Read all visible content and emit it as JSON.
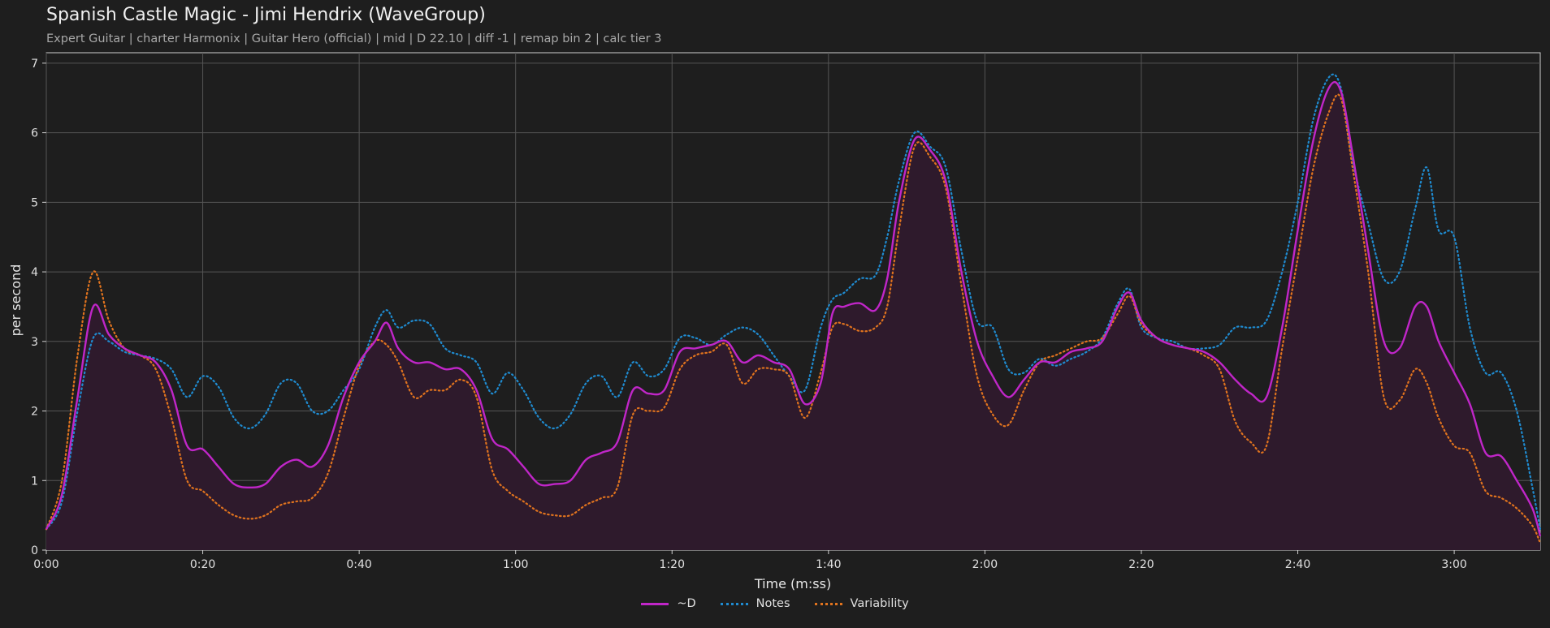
{
  "header": {
    "title": "Spanish Castle Magic - Jimi Hendrix (WaveGroup)",
    "subtitle": "Expert Guitar  |  charter Harmonix  |  Guitar Hero (official)  |  mid  |  D 22.10  |  diff -1  |  remap bin 2  |  calc tier 3"
  },
  "colors": {
    "background": "#1e1e1e",
    "plot_background": "#1e1e1e",
    "grid": "#555555",
    "d_series": "#c026c8",
    "notes_series": "#1f8bd0",
    "variability_series": "#e0731e",
    "d_fill": "#2e1a2c"
  },
  "chart_data": {
    "type": "line",
    "title": "Spanish Castle Magic - Jimi Hendrix (WaveGroup)",
    "xlabel": "Time (m:ss)",
    "ylabel": "per second",
    "xlim": [
      0,
      191
    ],
    "ylim": [
      0,
      7.15
    ],
    "x_ticks": [
      0,
      20,
      40,
      60,
      80,
      100,
      120,
      140,
      160,
      180
    ],
    "x_tick_labels": [
      "0:00",
      "0:20",
      "0:40",
      "1:00",
      "1:20",
      "1:40",
      "2:00",
      "2:20",
      "2:40",
      "3:00"
    ],
    "y_ticks": [
      0,
      1,
      2,
      3,
      4,
      5,
      6,
      7
    ],
    "y_tick_labels": [
      "0",
      "1",
      "2",
      "3",
      "4",
      "5",
      "6",
      "7"
    ],
    "grid": true,
    "legend_position": "bottom-center",
    "series": [
      {
        "name": "~D",
        "style": "solid",
        "filled": true,
        "points": [
          [
            0,
            0.3
          ],
          [
            2,
            0.8
          ],
          [
            4,
            2.2
          ],
          [
            6,
            3.5
          ],
          [
            8,
            3.1
          ],
          [
            10,
            2.9
          ],
          [
            12,
            2.8
          ],
          [
            14,
            2.7
          ],
          [
            16,
            2.3
          ],
          [
            18,
            1.5
          ],
          [
            20,
            1.45
          ],
          [
            22,
            1.2
          ],
          [
            24,
            0.95
          ],
          [
            26,
            0.9
          ],
          [
            28,
            0.95
          ],
          [
            30,
            1.2
          ],
          [
            32,
            1.3
          ],
          [
            34,
            1.2
          ],
          [
            36,
            1.5
          ],
          [
            38,
            2.2
          ],
          [
            40,
            2.7
          ],
          [
            42,
            3.0
          ],
          [
            43.5,
            3.27
          ],
          [
            45,
            2.9
          ],
          [
            47,
            2.7
          ],
          [
            49,
            2.7
          ],
          [
            51,
            2.6
          ],
          [
            53,
            2.6
          ],
          [
            55,
            2.3
          ],
          [
            57,
            1.6
          ],
          [
            59,
            1.45
          ],
          [
            61,
            1.2
          ],
          [
            63,
            0.95
          ],
          [
            65,
            0.95
          ],
          [
            67,
            1.0
          ],
          [
            69,
            1.3
          ],
          [
            71,
            1.4
          ],
          [
            73,
            1.55
          ],
          [
            75,
            2.3
          ],
          [
            77,
            2.25
          ],
          [
            79,
            2.3
          ],
          [
            81,
            2.85
          ],
          [
            83,
            2.9
          ],
          [
            85,
            2.95
          ],
          [
            87,
            3.0
          ],
          [
            89,
            2.7
          ],
          [
            91,
            2.8
          ],
          [
            93,
            2.7
          ],
          [
            95,
            2.6
          ],
          [
            97,
            2.1
          ],
          [
            99,
            2.4
          ],
          [
            100.5,
            3.4
          ],
          [
            102,
            3.5
          ],
          [
            104,
            3.55
          ],
          [
            106,
            3.45
          ],
          [
            107.5,
            3.9
          ],
          [
            109,
            5.0
          ],
          [
            111,
            5.9
          ],
          [
            113,
            5.75
          ],
          [
            115,
            5.3
          ],
          [
            117,
            4.0
          ],
          [
            119,
            3.0
          ],
          [
            121,
            2.5
          ],
          [
            123,
            2.2
          ],
          [
            125,
            2.45
          ],
          [
            127,
            2.7
          ],
          [
            129,
            2.7
          ],
          [
            131,
            2.85
          ],
          [
            133,
            2.9
          ],
          [
            135,
            3.0
          ],
          [
            137,
            3.5
          ],
          [
            138.5,
            3.7
          ],
          [
            140,
            3.3
          ],
          [
            142,
            3.05
          ],
          [
            144,
            2.95
          ],
          [
            146,
            2.9
          ],
          [
            148,
            2.85
          ],
          [
            150,
            2.7
          ],
          [
            152,
            2.45
          ],
          [
            154,
            2.25
          ],
          [
            156,
            2.2
          ],
          [
            158,
            3.2
          ],
          [
            160,
            4.6
          ],
          [
            162,
            5.9
          ],
          [
            164,
            6.65
          ],
          [
            165.5,
            6.6
          ],
          [
            167,
            5.7
          ],
          [
            169,
            4.3
          ],
          [
            171,
            3.0
          ],
          [
            173,
            2.9
          ],
          [
            175,
            3.5
          ],
          [
            176.5,
            3.5
          ],
          [
            178,
            3.0
          ],
          [
            180,
            2.55
          ],
          [
            182,
            2.1
          ],
          [
            184,
            1.4
          ],
          [
            186,
            1.35
          ],
          [
            188,
            1.0
          ],
          [
            190,
            0.6
          ],
          [
            191,
            0.2
          ]
        ]
      },
      {
        "name": "Notes",
        "style": "dotted",
        "filled": false,
        "points": [
          [
            0,
            0.3
          ],
          [
            2,
            0.7
          ],
          [
            4,
            2.0
          ],
          [
            6,
            3.05
          ],
          [
            8,
            3.0
          ],
          [
            10,
            2.85
          ],
          [
            12,
            2.8
          ],
          [
            14,
            2.75
          ],
          [
            16,
            2.6
          ],
          [
            18,
            2.2
          ],
          [
            20,
            2.5
          ],
          [
            22,
            2.35
          ],
          [
            24,
            1.9
          ],
          [
            26,
            1.75
          ],
          [
            28,
            1.95
          ],
          [
            30,
            2.4
          ],
          [
            32,
            2.4
          ],
          [
            34,
            2.0
          ],
          [
            36,
            2.0
          ],
          [
            38,
            2.3
          ],
          [
            40,
            2.6
          ],
          [
            42,
            3.2
          ],
          [
            43.5,
            3.45
          ],
          [
            45,
            3.2
          ],
          [
            47,
            3.3
          ],
          [
            49,
            3.25
          ],
          [
            51,
            2.9
          ],
          [
            53,
            2.8
          ],
          [
            55,
            2.7
          ],
          [
            57,
            2.25
          ],
          [
            59,
            2.55
          ],
          [
            61,
            2.3
          ],
          [
            63,
            1.9
          ],
          [
            65,
            1.75
          ],
          [
            67,
            1.95
          ],
          [
            69,
            2.4
          ],
          [
            71,
            2.5
          ],
          [
            73,
            2.2
          ],
          [
            75,
            2.7
          ],
          [
            77,
            2.5
          ],
          [
            79,
            2.6
          ],
          [
            81,
            3.05
          ],
          [
            83,
            3.05
          ],
          [
            85,
            2.95
          ],
          [
            87,
            3.1
          ],
          [
            89,
            3.2
          ],
          [
            91,
            3.1
          ],
          [
            93,
            2.8
          ],
          [
            95,
            2.5
          ],
          [
            97,
            2.3
          ],
          [
            99,
            3.2
          ],
          [
            100.5,
            3.6
          ],
          [
            102,
            3.7
          ],
          [
            104,
            3.9
          ],
          [
            106,
            3.95
          ],
          [
            107.5,
            4.5
          ],
          [
            109,
            5.3
          ],
          [
            111,
            6.0
          ],
          [
            113,
            5.8
          ],
          [
            115,
            5.5
          ],
          [
            117,
            4.3
          ],
          [
            119,
            3.3
          ],
          [
            121,
            3.2
          ],
          [
            123,
            2.6
          ],
          [
            125,
            2.55
          ],
          [
            127,
            2.75
          ],
          [
            129,
            2.65
          ],
          [
            131,
            2.75
          ],
          [
            133,
            2.85
          ],
          [
            135,
            3.05
          ],
          [
            137,
            3.55
          ],
          [
            138.5,
            3.75
          ],
          [
            140,
            3.2
          ],
          [
            142,
            3.05
          ],
          [
            144,
            3.0
          ],
          [
            146,
            2.9
          ],
          [
            148,
            2.9
          ],
          [
            150,
            2.95
          ],
          [
            152,
            3.2
          ],
          [
            154,
            3.2
          ],
          [
            156,
            3.3
          ],
          [
            158,
            4.0
          ],
          [
            160,
            5.0
          ],
          [
            162,
            6.2
          ],
          [
            164,
            6.8
          ],
          [
            165.5,
            6.65
          ],
          [
            167,
            5.6
          ],
          [
            169,
            4.7
          ],
          [
            171,
            3.9
          ],
          [
            173,
            4.0
          ],
          [
            175,
            4.9
          ],
          [
            176.5,
            5.5
          ],
          [
            178,
            4.6
          ],
          [
            180,
            4.5
          ],
          [
            182,
            3.2
          ],
          [
            184,
            2.55
          ],
          [
            186,
            2.55
          ],
          [
            188,
            2.0
          ],
          [
            190,
            0.9
          ],
          [
            191,
            0.3
          ]
        ]
      },
      {
        "name": "Variability",
        "style": "dotted",
        "filled": false,
        "points": [
          [
            0,
            0.3
          ],
          [
            2,
            1.0
          ],
          [
            4,
            2.8
          ],
          [
            6,
            4.0
          ],
          [
            8,
            3.3
          ],
          [
            10,
            2.9
          ],
          [
            12,
            2.8
          ],
          [
            14,
            2.6
          ],
          [
            16,
            1.9
          ],
          [
            18,
            1.0
          ],
          [
            20,
            0.85
          ],
          [
            22,
            0.65
          ],
          [
            24,
            0.5
          ],
          [
            26,
            0.45
          ],
          [
            28,
            0.5
          ],
          [
            30,
            0.65
          ],
          [
            32,
            0.7
          ],
          [
            34,
            0.75
          ],
          [
            36,
            1.1
          ],
          [
            38,
            1.9
          ],
          [
            40,
            2.65
          ],
          [
            42,
            3.0
          ],
          [
            43.5,
            2.95
          ],
          [
            45,
            2.7
          ],
          [
            47,
            2.2
          ],
          [
            49,
            2.3
          ],
          [
            51,
            2.3
          ],
          [
            53,
            2.45
          ],
          [
            55,
            2.2
          ],
          [
            57,
            1.15
          ],
          [
            59,
            0.85
          ],
          [
            61,
            0.7
          ],
          [
            63,
            0.55
          ],
          [
            65,
            0.5
          ],
          [
            67,
            0.5
          ],
          [
            69,
            0.65
          ],
          [
            71,
            0.75
          ],
          [
            73,
            0.9
          ],
          [
            75,
            1.95
          ],
          [
            77,
            2.0
          ],
          [
            79,
            2.05
          ],
          [
            81,
            2.6
          ],
          [
            83,
            2.8
          ],
          [
            85,
            2.85
          ],
          [
            87,
            2.95
          ],
          [
            89,
            2.4
          ],
          [
            91,
            2.6
          ],
          [
            93,
            2.6
          ],
          [
            95,
            2.5
          ],
          [
            97,
            1.9
          ],
          [
            99,
            2.55
          ],
          [
            100.5,
            3.2
          ],
          [
            102,
            3.25
          ],
          [
            104,
            3.15
          ],
          [
            106,
            3.2
          ],
          [
            107.5,
            3.5
          ],
          [
            109,
            4.6
          ],
          [
            111,
            5.8
          ],
          [
            113,
            5.65
          ],
          [
            115,
            5.2
          ],
          [
            117,
            3.8
          ],
          [
            119,
            2.5
          ],
          [
            121,
            1.95
          ],
          [
            123,
            1.8
          ],
          [
            125,
            2.3
          ],
          [
            127,
            2.7
          ],
          [
            129,
            2.8
          ],
          [
            131,
            2.9
          ],
          [
            133,
            3.0
          ],
          [
            135,
            3.05
          ],
          [
            137,
            3.4
          ],
          [
            138.5,
            3.65
          ],
          [
            140,
            3.25
          ],
          [
            142,
            3.05
          ],
          [
            144,
            2.95
          ],
          [
            146,
            2.9
          ],
          [
            148,
            2.8
          ],
          [
            150,
            2.6
          ],
          [
            152,
            1.85
          ],
          [
            154,
            1.55
          ],
          [
            156,
            1.5
          ],
          [
            158,
            2.9
          ],
          [
            160,
            4.2
          ],
          [
            162,
            5.5
          ],
          [
            164,
            6.3
          ],
          [
            165.5,
            6.5
          ],
          [
            167,
            5.5
          ],
          [
            169,
            4.0
          ],
          [
            171,
            2.2
          ],
          [
            173,
            2.15
          ],
          [
            175,
            2.6
          ],
          [
            176.5,
            2.4
          ],
          [
            178,
            1.9
          ],
          [
            180,
            1.5
          ],
          [
            182,
            1.4
          ],
          [
            184,
            0.85
          ],
          [
            186,
            0.75
          ],
          [
            188,
            0.6
          ],
          [
            190,
            0.35
          ],
          [
            191,
            0.1
          ]
        ]
      }
    ]
  }
}
